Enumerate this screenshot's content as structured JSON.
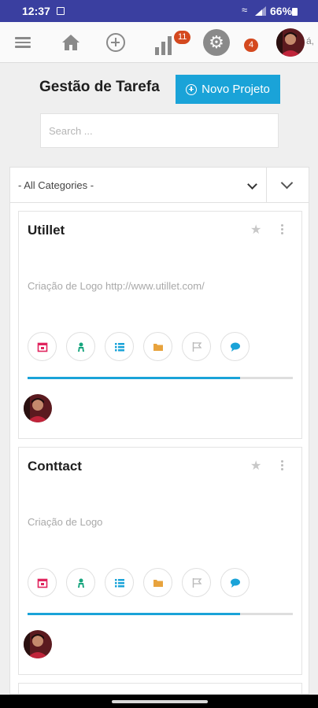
{
  "status_bar": {
    "time": "12:37",
    "battery": "66%"
  },
  "nav": {
    "notifications_count": "11",
    "alerts_count": "4",
    "avatar_suffix": "á,"
  },
  "header": {
    "title": "Gestão de Tarefa",
    "new_project_label": "Novo Projeto"
  },
  "search": {
    "placeholder": "Search ..."
  },
  "filter": {
    "category_selected": "- All Categories -"
  },
  "colors": {
    "accent": "#1aa3d8",
    "statusbar": "#3a3fa0",
    "badge": "#d4491f"
  },
  "projects": [
    {
      "title": "Utillet",
      "description": "Criação de Logo http://www.utillet.com/",
      "progress": 0.8
    },
    {
      "title": "Conttact",
      "description": "Criação de Logo",
      "progress": 0.8
    }
  ],
  "card_actions": [
    {
      "icon": "calendar-icon",
      "color": "#e0245e"
    },
    {
      "icon": "users-icon",
      "color": "#17a57e"
    },
    {
      "icon": "list-icon",
      "color": "#1aa3d8"
    },
    {
      "icon": "folder-icon",
      "color": "#e8a33d"
    },
    {
      "icon": "flag-icon",
      "color": "#b8b8b8"
    },
    {
      "icon": "comment-icon",
      "color": "#1aa3d8"
    }
  ]
}
